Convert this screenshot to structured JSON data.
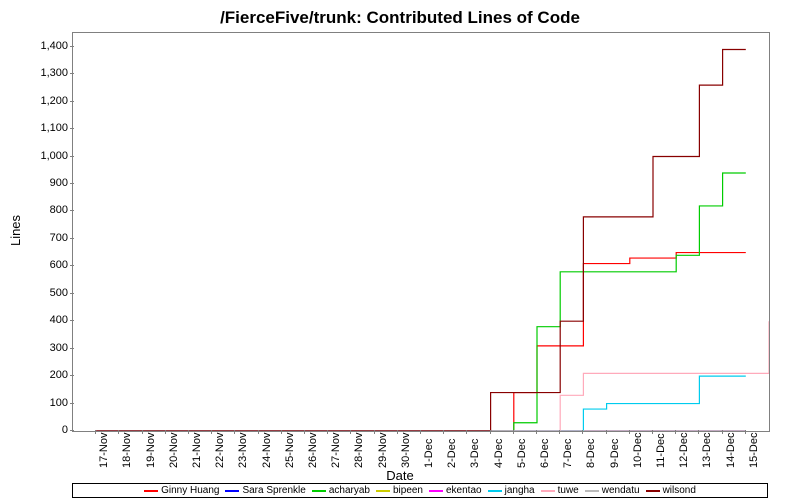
{
  "chart_data": {
    "type": "line",
    "title": "/FierceFive/trunk: Contributed Lines of Code",
    "xlabel": "Date",
    "ylabel": "Lines",
    "ylim": [
      0,
      1450
    ],
    "xlim": [
      0,
      30
    ],
    "y_ticks": [
      0,
      100,
      200,
      300,
      400,
      500,
      600,
      700,
      800,
      900,
      1000,
      1100,
      1200,
      1300,
      1400
    ],
    "x_categories": [
      "17-Nov",
      "18-Nov",
      "19-Nov",
      "20-Nov",
      "21-Nov",
      "22-Nov",
      "23-Nov",
      "24-Nov",
      "25-Nov",
      "26-Nov",
      "27-Nov",
      "28-Nov",
      "29-Nov",
      "30-Nov",
      "1-Dec",
      "2-Dec",
      "3-Dec",
      "4-Dec",
      "5-Dec",
      "6-Dec",
      "7-Dec",
      "8-Dec",
      "9-Dec",
      "10-Dec",
      "11-Dec",
      "12-Dec",
      "13-Dec",
      "14-Dec",
      "15-Dec"
    ],
    "series": [
      {
        "name": "Ginny Huang",
        "color": "#ff0000",
        "values": [
          0,
          0,
          0,
          0,
          0,
          0,
          0,
          0,
          0,
          0,
          0,
          0,
          0,
          0,
          0,
          0,
          0,
          0,
          140,
          310,
          310,
          610,
          610,
          630,
          630,
          650,
          650,
          650,
          650
        ]
      },
      {
        "name": "Sara Sprenkle",
        "color": "#0000ff",
        "values": [
          0,
          0,
          0,
          0,
          0,
          0,
          0,
          0,
          0,
          0,
          0,
          0,
          0,
          0,
          0,
          0,
          0,
          0,
          0,
          0,
          0,
          0,
          0,
          0,
          0,
          0,
          0,
          0,
          0
        ]
      },
      {
        "name": "acharyab",
        "color": "#00cc00",
        "values": [
          0,
          0,
          0,
          0,
          0,
          0,
          0,
          0,
          0,
          0,
          0,
          0,
          0,
          0,
          0,
          0,
          0,
          0,
          30,
          380,
          580,
          580,
          580,
          580,
          580,
          640,
          820,
          940,
          940
        ]
      },
      {
        "name": "bipeen",
        "color": "#cccc00",
        "values": [
          0,
          0,
          0,
          0,
          0,
          0,
          0,
          0,
          0,
          0,
          0,
          0,
          0,
          0,
          0,
          0,
          0,
          0,
          0,
          0,
          0,
          0,
          0,
          0,
          0,
          0,
          0,
          0,
          0
        ]
      },
      {
        "name": "ekentao",
        "color": "#ff00ff",
        "values": [
          0,
          0,
          0,
          0,
          0,
          0,
          0,
          0,
          0,
          0,
          0,
          0,
          0,
          0,
          0,
          0,
          0,
          0,
          0,
          0,
          0,
          0,
          0,
          0,
          0,
          0,
          0,
          0,
          0
        ]
      },
      {
        "name": "jangha",
        "color": "#00ccee",
        "values": [
          0,
          0,
          0,
          0,
          0,
          0,
          0,
          0,
          0,
          0,
          0,
          0,
          0,
          0,
          0,
          0,
          0,
          0,
          0,
          0,
          0,
          80,
          100,
          100,
          100,
          100,
          200,
          200,
          200
        ]
      },
      {
        "name": "tuwe",
        "color": "#ffaabb",
        "values": [
          0,
          0,
          0,
          0,
          0,
          0,
          0,
          0,
          0,
          0,
          0,
          0,
          0,
          0,
          0,
          0,
          0,
          0,
          0,
          0,
          130,
          210,
          210,
          210,
          210,
          210,
          210,
          210,
          210,
          400
        ]
      },
      {
        "name": "wendatu",
        "color": "#bbbbbb",
        "values": [
          0,
          0,
          0,
          0,
          0,
          0,
          0,
          0,
          0,
          0,
          0,
          0,
          0,
          0,
          0,
          0,
          0,
          0,
          0,
          0,
          0,
          0,
          0,
          0,
          0,
          0,
          0,
          0,
          0
        ]
      },
      {
        "name": "wilsond",
        "color": "#880000",
        "values": [
          0,
          0,
          0,
          0,
          0,
          0,
          0,
          0,
          0,
          0,
          0,
          0,
          0,
          0,
          0,
          0,
          0,
          140,
          140,
          140,
          400,
          780,
          780,
          780,
          1000,
          1000,
          1260,
          1390,
          1390
        ]
      }
    ]
  }
}
